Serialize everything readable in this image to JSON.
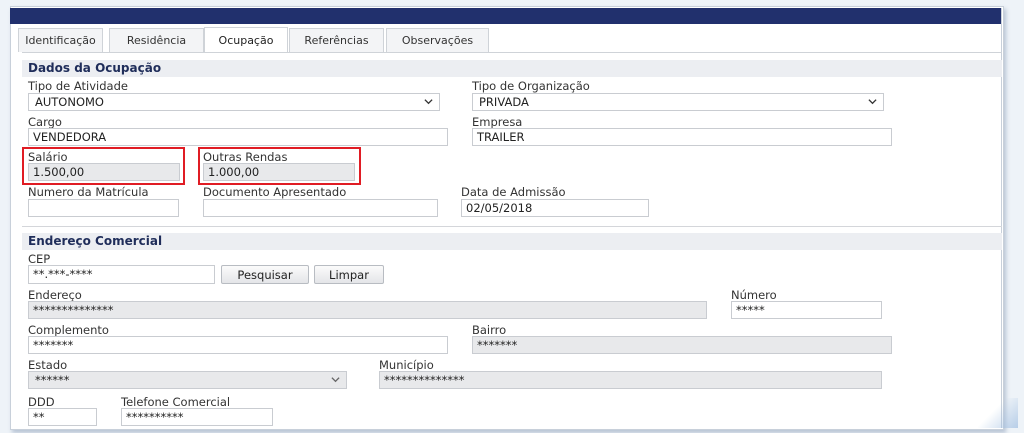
{
  "tabs": [
    {
      "label": "Identificação"
    },
    {
      "label": "Residência"
    },
    {
      "label": "Ocupação"
    },
    {
      "label": "Referências"
    },
    {
      "label": "Observações"
    }
  ],
  "ocupacao": {
    "section_title": "Dados da Ocupação",
    "tipo_atividade": {
      "label": "Tipo de Atividade",
      "value": "AUTONOMO"
    },
    "tipo_organizacao": {
      "label": "Tipo de Organização",
      "value": "PRIVADA"
    },
    "cargo": {
      "label": "Cargo",
      "value": "VENDEDORA"
    },
    "empresa": {
      "label": "Empresa",
      "value": "TRAILER"
    },
    "salario": {
      "label": "Salário",
      "value": "1.500,00"
    },
    "outras_rendas": {
      "label": "Outras Rendas",
      "value": "1.000,00"
    },
    "matricula": {
      "label": "Numero da Matrícula",
      "value": ""
    },
    "documento": {
      "label": "Documento Apresentado",
      "value": ""
    },
    "admissao": {
      "label": "Data de Admissão",
      "value": "02/05/2018"
    }
  },
  "endereco": {
    "section_title": "Endereço Comercial",
    "cep": {
      "label": "CEP",
      "value": "**.***-****"
    },
    "pesquisar_label": "Pesquisar",
    "limpar_label": "Limpar",
    "endereco": {
      "label": "Endereço",
      "value": "**************"
    },
    "numero": {
      "label": "Número",
      "value": "*****"
    },
    "complemento": {
      "label": "Complemento",
      "value": "*******"
    },
    "bairro": {
      "label": "Bairro",
      "value": "*******"
    },
    "estado": {
      "label": "Estado",
      "value": "******"
    },
    "municipio": {
      "label": "Município",
      "value": "**************"
    },
    "ddd": {
      "label": "DDD",
      "value": "**"
    },
    "telefone": {
      "label": "Telefone Comercial",
      "value": "**********"
    }
  },
  "colors": {
    "header_bar": "#21306d",
    "highlight_box": "#e01c24",
    "section_bg": "#eceef2"
  }
}
